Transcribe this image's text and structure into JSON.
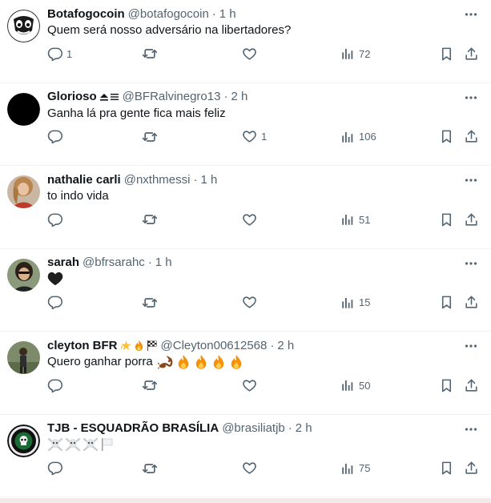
{
  "tweets": [
    {
      "name": "Botafogocoin",
      "handle": "@botafogocoin",
      "sep": "·",
      "time": "1 h",
      "text": "Quem será nosso adversário na libertadores?",
      "replies": "1",
      "retweets": "",
      "likes": "",
      "views": "72",
      "avatar_icon": "botafogo-coin-logo-icon"
    },
    {
      "name": "Glorioso",
      "handle": "@BFRalvinegro13",
      "sep": "·",
      "time": "2 h",
      "badge_icons": [
        "eject-icon",
        "menu-lines-icon"
      ],
      "text": "Ganha lá pra gente fica mais feliz",
      "replies": "",
      "retweets": "",
      "likes": "1",
      "views": "106",
      "avatar_icon": "black-circle-avatar"
    },
    {
      "name": "nathalie carli",
      "handle": "@nxthmessi",
      "sep": "·",
      "time": "1 h",
      "text": "to indo vida",
      "replies": "",
      "retweets": "",
      "likes": "",
      "views": "51",
      "avatar_icon": "photo-avatar"
    },
    {
      "name": "sarah",
      "handle": "@bfrsarahc",
      "sep": "·",
      "time": "1 h",
      "text_icons": [
        "black-heart-icon"
      ],
      "text": "",
      "replies": "",
      "retweets": "",
      "likes": "",
      "views": "15",
      "avatar_icon": "photo-avatar"
    },
    {
      "name": "cleyton BFR",
      "handle": "@Cleyton00612568",
      "sep": "·",
      "time": "2 h",
      "badge_icons": [
        "dizzy-icon",
        "fire-icon",
        "checkered-flag-icon"
      ],
      "text": "Quero ganhar porra",
      "text_icons": [
        "scorpion-icon",
        "fire-icon",
        "fire-icon",
        "fire-icon",
        "fire-icon"
      ],
      "replies": "",
      "retweets": "",
      "likes": "",
      "views": "50",
      "avatar_icon": "photo-avatar"
    },
    {
      "name": "TJB - ESQUADRÃO BRASÍLIA",
      "handle": "@brasiliatjb",
      "sep": "·",
      "time": "2 h",
      "text": "",
      "text_icons": [
        "skull-crossbones-icon",
        "skull-crossbones-icon",
        "skull-crossbones-icon",
        "white-flag-icon"
      ],
      "replies": "",
      "retweets": "",
      "likes": "",
      "views": "75",
      "avatar_icon": "tjb-crest-logo-icon"
    }
  ],
  "colors": {
    "text": "#0f1419",
    "secondary": "#536471",
    "divider": "#eff3f4"
  }
}
